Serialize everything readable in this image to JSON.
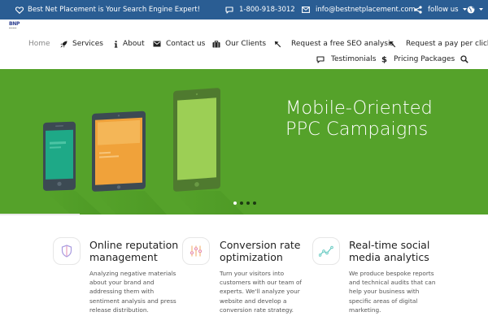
{
  "topbar": {
    "tagline": "Best Net Placement is Your Search Engine Expert!",
    "phone": "1-800-918-3012",
    "email": "info@bestnetplacement.com",
    "follow_label": "follow us"
  },
  "logo": {
    "text": "BNP"
  },
  "nav": {
    "home": "Home",
    "services": "Services",
    "about": "About",
    "contact": "Contact us",
    "clients": "Our Clients",
    "seo": "Request a free SEO analysis",
    "ppc": "Request a pay per click",
    "testimonials": "Testimonials",
    "pricing": "Pricing Packages"
  },
  "hero": {
    "title_line1": "Mobile-Oriented",
    "title_line2": "PPC Campaigns",
    "slide_count": 4,
    "active_slide": 1
  },
  "features": [
    {
      "icon": "shield-icon",
      "title_lines": [
        "Online reputation",
        "management"
      ],
      "text_lines": [
        "Analyzing negative materials",
        "about your brand and",
        "addressing them with",
        "sentiment analysis and press",
        "release distribution."
      ]
    },
    {
      "icon": "sliders-icon",
      "title_lines": [
        "Conversion rate",
        "optimization"
      ],
      "text_lines": [
        "Turn your visitors into",
        "customers with our team of",
        "experts. We'll analyze your",
        "website and develop a",
        "conversion rate strategy."
      ]
    },
    {
      "icon": "chart-line-icon",
      "title_lines": [
        "Real-time social",
        "media analytics"
      ],
      "text_lines": [
        "We produce bespoke reports",
        "and technical audits that can",
        "help your business with",
        "specific areas of digital",
        "marketing."
      ]
    }
  ],
  "colors": {
    "topbar": "#2a5d93",
    "hero_green": "#55a22a",
    "accent_pink": "#e48bb0",
    "accent_orange": "#f0a860",
    "accent_teal": "#5cc6bd"
  }
}
